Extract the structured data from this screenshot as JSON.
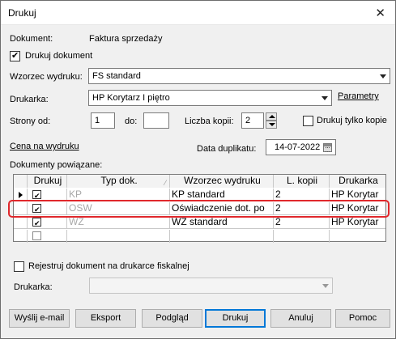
{
  "window": {
    "title": "Drukuj",
    "close_icon": "close-icon"
  },
  "document": {
    "label": "Dokument:",
    "value": "Faktura sprzedaży"
  },
  "print_document": {
    "label": "Drukuj dokument",
    "checked": true
  },
  "template": {
    "label": "Wzorzec wydruku:",
    "value": "FS standard"
  },
  "printer": {
    "label": "Drukarka:",
    "value": "HP Korytarz I piętro",
    "params_link": "Parametry"
  },
  "pages": {
    "from_label": "Strony od:",
    "from_value": "1",
    "to_label": "do:",
    "to_value": ""
  },
  "copies": {
    "label": "Liczba kopii:",
    "value": "2"
  },
  "print_copies_only": {
    "label": "Drukuj tylko kopie",
    "checked": false
  },
  "price_link": "Cena na wydruku",
  "duplicate_date": {
    "label": "Data duplikatu:",
    "value": "14-07-2022"
  },
  "related_docs": {
    "label": "Dokumenty powiązane:",
    "columns": [
      "Drukuj",
      "Typ dok.",
      "Wzorzec wydruku",
      "L. kopii",
      "Drukarka"
    ],
    "rows": [
      {
        "print": true,
        "type": "KP",
        "template": "KP standard",
        "copies": "2",
        "printer": "HP Korytar"
      },
      {
        "print": true,
        "type": "OSW",
        "template": "Oświadczenie dot. po",
        "copies": "2",
        "printer": "HP Korytar"
      },
      {
        "print": true,
        "type": "WZ",
        "template": "WZ standard",
        "copies": "2",
        "printer": "HP Korytar"
      },
      {
        "print": false,
        "type": "",
        "template": "",
        "copies": "",
        "printer": ""
      }
    ]
  },
  "fiscal": {
    "label": "Rejestruj dokument na drukarce fiskalnej",
    "checked": false,
    "printer_label": "Drukarka:",
    "printer_value": ""
  },
  "buttons": {
    "email": "Wyślij e-mail",
    "export": "Eksport",
    "preview": "Podgląd",
    "print": "Drukuj",
    "cancel": "Anuluj",
    "help": "Pomoc"
  },
  "colors": {
    "highlight": "#e0282c",
    "accent": "#0078d7"
  }
}
